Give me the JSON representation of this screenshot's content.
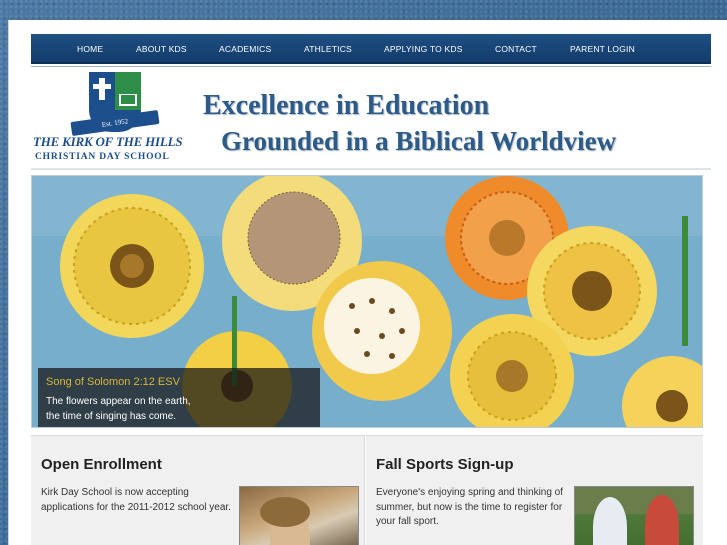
{
  "nav": {
    "items": [
      "HOME",
      "ABOUT KDS",
      "ACADEMICS",
      "ATHLETICS",
      "APPLYING TO KDS",
      "CONTACT",
      "PARENT LOGIN"
    ]
  },
  "logo": {
    "banner": "Est. 1952",
    "name": "THE KIRK OF THE HILLS",
    "sub": "Christian Day School"
  },
  "header": {
    "tagline_line1": "Excellence in Education",
    "tagline_line2": "Grounded in a Biblical Worldview"
  },
  "hero": {
    "caption_title": "Song of Solomon 2:12 ESV",
    "caption_line1": "The flowers appear on the earth,",
    "caption_line2": "the time of singing has come."
  },
  "columns": [
    {
      "title": "Open Enrollment",
      "text1": "Kirk Day School is now accepting applications for the 2011-2012 school year.",
      "text2": ""
    },
    {
      "title": "Fall Sports Sign-up",
      "text1": "Everyone's enjoying spring and thinking of summer, but now is the time to register for your fall sport.",
      "text2": ""
    }
  ],
  "colors": {
    "nav_bg": "#1f4f83",
    "brand_blue": "#1d4f8c",
    "brand_green": "#2d8f47",
    "tagline": "#2d5a86",
    "caption_title": "#d7b53c"
  },
  "icons": [
    "cross-icon",
    "book-icon"
  ]
}
